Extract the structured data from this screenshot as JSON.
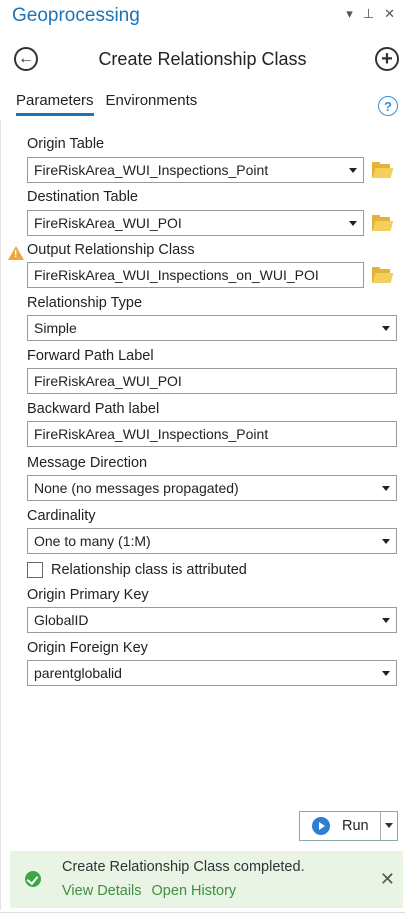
{
  "panel": {
    "title": "Geoprocessing",
    "menu_icon": "chevron-down-icon",
    "pin_icon": "pin-icon",
    "close_icon": "close-icon"
  },
  "nav": {
    "title": "Create Relationship Class",
    "back_icon": "back-arrow-icon",
    "add_icon": "plus-circle-icon"
  },
  "tabs": [
    {
      "label": "Parameters",
      "active": true
    },
    {
      "label": "Environments",
      "active": false
    }
  ],
  "help_icon_char": "?",
  "params": {
    "origin_table": {
      "label": "Origin Table",
      "value": "FireRiskArea_WUI_Inspections_Point"
    },
    "destination_table": {
      "label": "Destination Table",
      "value": "FireRiskArea_WUI_POI"
    },
    "output_relationship_class": {
      "label": "Output Relationship Class",
      "value": "FireRiskArea_WUI_Inspections_on_WUI_POI"
    },
    "relationship_type": {
      "label": "Relationship Type",
      "value": "Simple"
    },
    "forward_path_label": {
      "label": "Forward Path Label",
      "value": "FireRiskArea_WUI_POI"
    },
    "backward_path_label": {
      "label": "Backward Path label",
      "value": "FireRiskArea_WUI_Inspections_Point"
    },
    "message_direction": {
      "label": "Message Direction",
      "value": "None (no messages propagated)"
    },
    "cardinality": {
      "label": "Cardinality",
      "value": "One to many (1:M)"
    },
    "attributed": {
      "label": "Relationship class is attributed",
      "checked": false
    },
    "origin_primary_key": {
      "label": "Origin Primary Key",
      "value": "GlobalID"
    },
    "origin_foreign_key": {
      "label": "Origin Foreign Key",
      "value": "parentglobalid"
    }
  },
  "run_button": {
    "label": "Run"
  },
  "status": {
    "message": "Create Relationship Class completed.",
    "view_details": "View Details",
    "open_history": "Open History",
    "close_char": "✕",
    "success_color": "#3ea648"
  },
  "colors": {
    "accent": "#1e73b4",
    "folder": "#e2b33a",
    "warning": "#f2a53a",
    "status_bg": "#e9f4e4"
  }
}
